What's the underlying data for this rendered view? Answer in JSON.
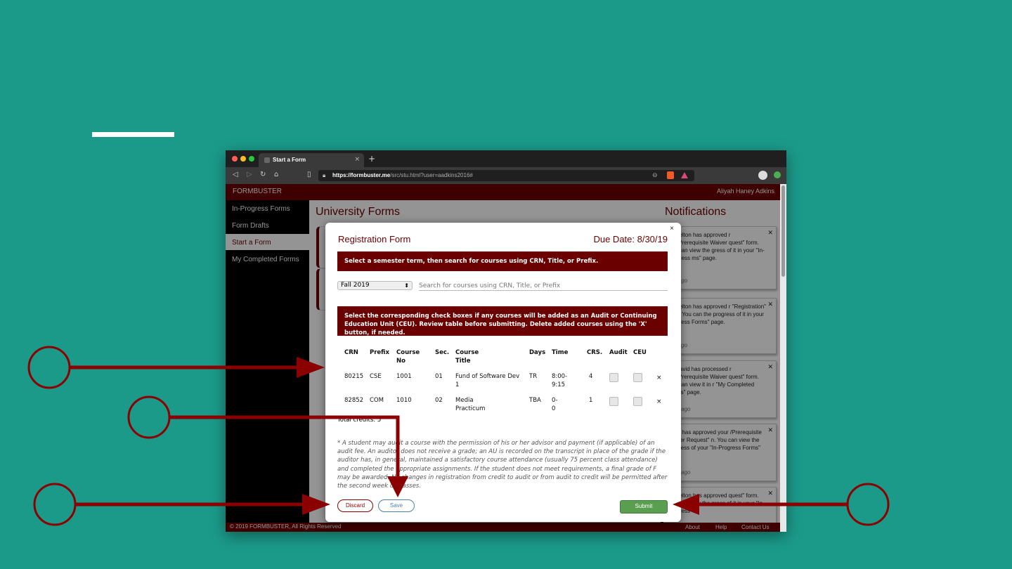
{
  "browser": {
    "tab_title": "Start a Form",
    "tab_close": "×",
    "new_tab": "+",
    "url_domain": "https://formbuster.me",
    "url_path": "/src/stu.html?user=aadkins2016#",
    "traffic_colors": [
      "#ff5f56",
      "#ffbd2e",
      "#27c93f"
    ]
  },
  "app": {
    "brand": "FORMBUSTER",
    "user": "Aliyah Haney Adkins",
    "accent": "#6b0000",
    "sidebar": [
      {
        "label": "In-Progress Forms"
      },
      {
        "label": "Form Drafts"
      },
      {
        "label": "Start a Form"
      },
      {
        "label": "My Completed Forms"
      }
    ],
    "main_title": "University Forms",
    "notifications_title": "Notifications",
    "notifications": [
      {
        "text": "a Shelton has approved r \"Co/Prerequisite Waiver quest\" form. You can view the gress of it in your \"In-Progress ms\" page.",
        "time": "ays ago"
      },
      {
        "text": "a Shelton has approved r \"Registration\" form. You can the progress of it in your \"In-gress Forms\" page.",
        "time": "ays ago"
      },
      {
        "text": "ee David has processed r \"Co/Prerequisite Waiver quest\" form. You can view it in r \"My Completed Forms\" page.",
        "time": "days ago"
      },
      {
        "text": "Frost has approved your /Prerequisite Waiver Request\" n. You can view the progress of your \"In-Progress Forms\" page.",
        "time": "days ago"
      },
      {
        "text": "a Shelton has approved quest\" form. You can view the gress of it in your \"In-Progress",
        "time": ""
      }
    ],
    "footer": {
      "copyright": "© 2019 FORMBUSTER, All Rights Reserved",
      "links": [
        "About",
        "Help",
        "Contact Us"
      ]
    }
  },
  "modal": {
    "close": "×",
    "title": "Registration Form",
    "due": "Due Date: 8/30/19",
    "banner1": "Select a semester term, then search for courses using CRN, Title, or Prefix.",
    "term": "Fall 2019",
    "search_placeholder": "Search for courses using CRN, Title, or Prefix",
    "banner2": "Select the corresponding check boxes if any courses will be added as an Audit or Continuing Education Unit (CEU). Review table before submitting. Delete added courses using the 'X' button, if needed.",
    "columns": [
      "CRN",
      "Prefix",
      "Course No",
      "Sec.",
      "Course Title",
      "Days",
      "Time",
      "CRS.",
      "Audit",
      "CEU"
    ],
    "rows": [
      {
        "crn": "80215",
        "prefix": "CSE",
        "course_no": "1001",
        "sec": "01",
        "title": "Fund of Software Dev 1",
        "days": "TR",
        "time": "8:00-9:15",
        "crs": "4",
        "remove": "×"
      },
      {
        "crn": "82852",
        "prefix": "COM",
        "course_no": "1010",
        "sec": "02",
        "title": "Media Practicum",
        "days": "TBA",
        "time": "0-0",
        "crs": "1",
        "remove": "×"
      }
    ],
    "total_credits": "Total credits: 5",
    "note": "* A student may audit a course with the permission of his or her advisor and payment (if applicable) of an audit fee. An auditor does not receive a grade; an AU is recorded on the transcript in place of the grade if the auditor has, in general, maintained a satisfactory course attendance (usually 75 percent class attendance) and completed the appropriate assignments. If the student does not meet requirements, a final grade of F may be awarded. No changes in registration from credit to audit or from audit to credit will be permitted after the second week of classes.",
    "discard": "Discard",
    "save": "Save",
    "submit": "Submit"
  },
  "annotations": {
    "color": "#8b0000"
  }
}
